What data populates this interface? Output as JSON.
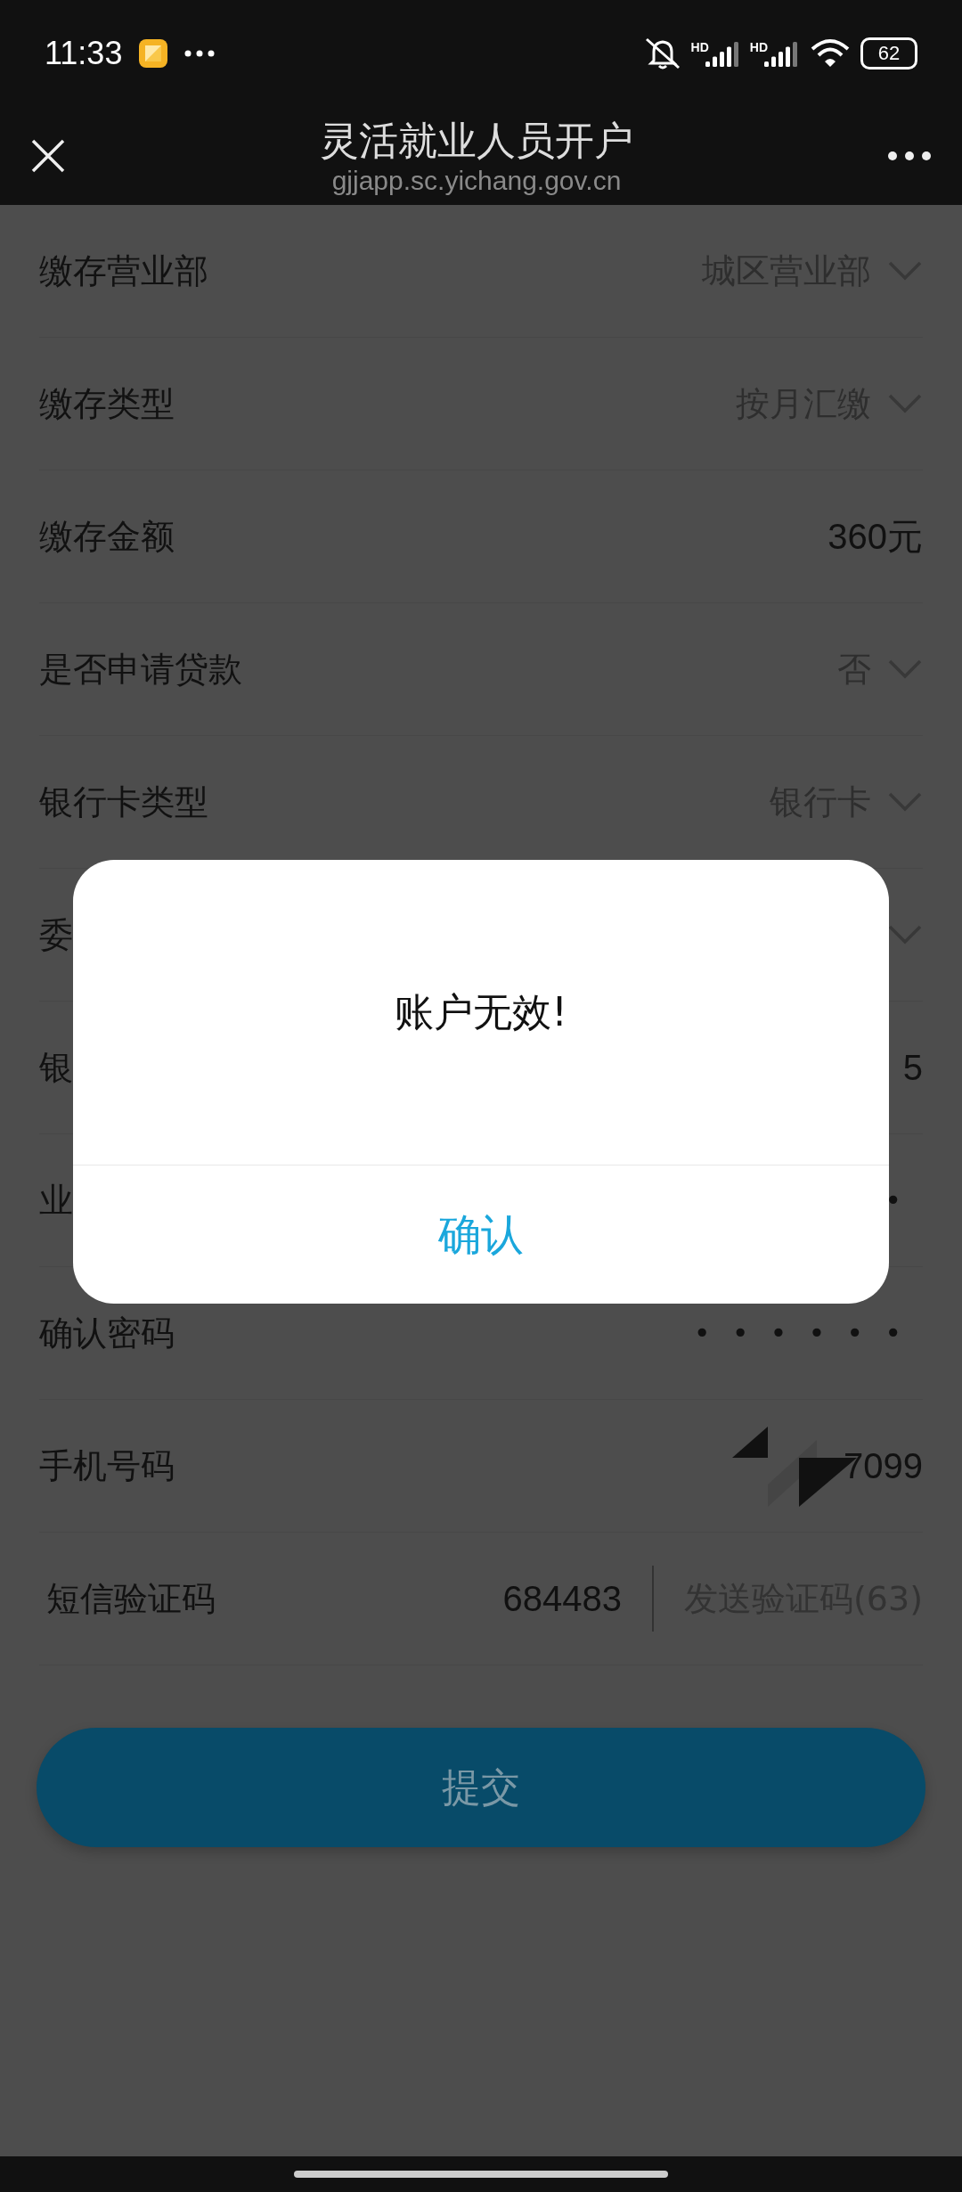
{
  "status_bar": {
    "time": "11:33",
    "signals": [
      {
        "label": "HD"
      },
      {
        "label": "HD"
      }
    ],
    "battery": "62"
  },
  "header": {
    "title": "灵活就业人员开户",
    "url": "gjjapp.sc.yichang.gov.cn"
  },
  "form": {
    "rows": [
      {
        "kind": "select",
        "label": "缴存营业部",
        "value": "城区营业部"
      },
      {
        "kind": "select",
        "label": "缴存类型",
        "value": "按月汇缴"
      },
      {
        "kind": "text",
        "label": "缴存金额",
        "value": "360元"
      },
      {
        "kind": "select",
        "label": "是否申请贷款",
        "value": "否"
      },
      {
        "kind": "select",
        "label": "银行卡类型",
        "value": "银行卡"
      },
      {
        "kind": "select",
        "label": "委"
      },
      {
        "kind": "text",
        "label": "银",
        "value": "5"
      },
      {
        "kind": "password",
        "label": "业",
        "value": "•"
      },
      {
        "kind": "password",
        "label": "确认密码",
        "value": "••••••"
      },
      {
        "kind": "redacted",
        "label": "手机号码",
        "value": "7099"
      },
      {
        "kind": "sms",
        "label": "短信验证码",
        "value": "684483",
        "button": "发送验证码(63)"
      }
    ],
    "submit": "提交"
  },
  "dialog": {
    "message": "账户无效!",
    "confirm": "确认"
  }
}
